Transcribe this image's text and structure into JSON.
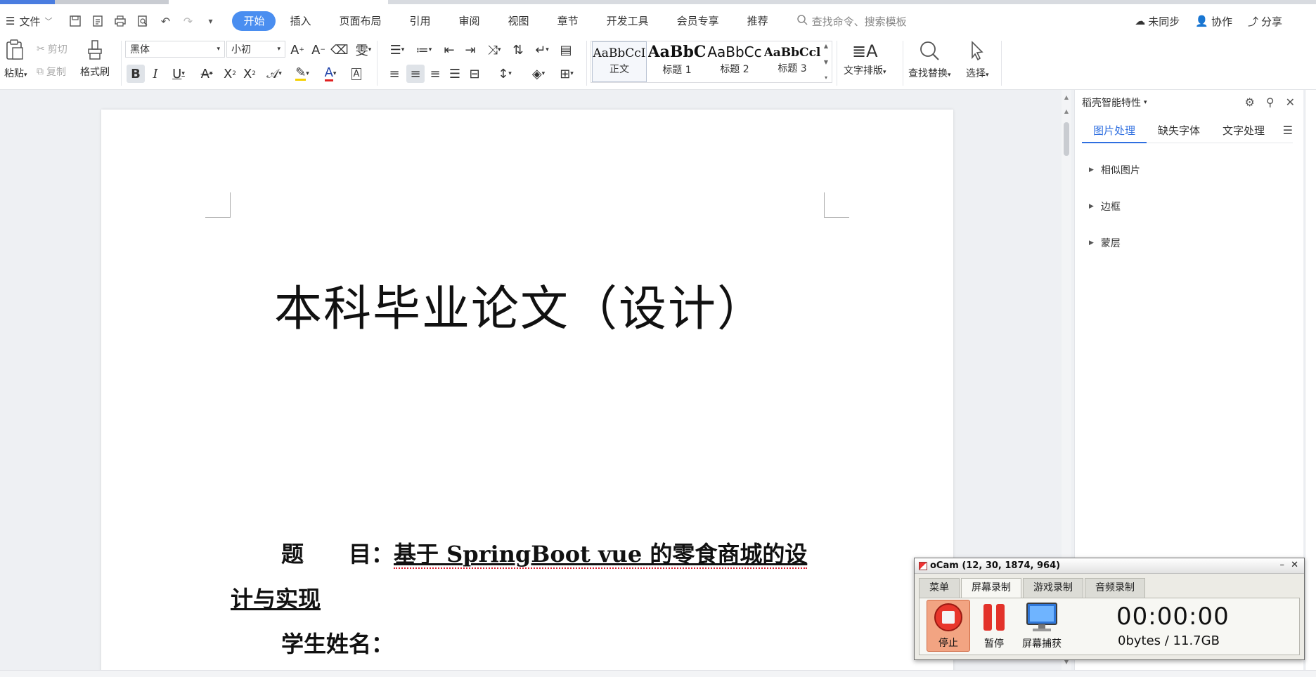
{
  "menubar": {
    "file_label": "文件",
    "tabs": [
      {
        "label": "开始",
        "active": true
      },
      {
        "label": "插入"
      },
      {
        "label": "页面布局"
      },
      {
        "label": "引用"
      },
      {
        "label": "审阅"
      },
      {
        "label": "视图"
      },
      {
        "label": "章节"
      },
      {
        "label": "开发工具"
      },
      {
        "label": "会员专享"
      },
      {
        "label": "推荐"
      }
    ],
    "search_placeholder": "查找命令、搜索模板",
    "right": {
      "sync": "未同步",
      "collab": "协作",
      "share": "分享"
    }
  },
  "ribbon": {
    "paste": "粘贴",
    "cut": "剪切",
    "copy": "复制",
    "format_painter": "格式刷",
    "font_name": "黑体",
    "font_size": "小初",
    "styles": [
      {
        "sample": "AaBbCcI",
        "label": "正文"
      },
      {
        "sample": "AaBbC",
        "label": "标题 1"
      },
      {
        "sample": "AaBbCc",
        "label": "标题 2"
      },
      {
        "sample": "AaBbCcl",
        "label": "标题 3"
      }
    ],
    "text_layout": "文字排版",
    "find_replace": "查找替换",
    "select": "选择"
  },
  "document": {
    "title": "本科毕业论文（设计）",
    "topic_label": "题　　目：",
    "topic_value_1": "基于 SpringBoot vue 的零食商城的设",
    "topic_value_2": "计与实现",
    "student_label": "学生姓名："
  },
  "panel": {
    "title": "稻壳智能特性",
    "tabs": [
      {
        "label": "图片处理",
        "active": true
      },
      {
        "label": "缺失字体"
      },
      {
        "label": "文字处理"
      }
    ],
    "sections": [
      "相似图片",
      "边框",
      "蒙层"
    ]
  },
  "ocam": {
    "title": "oCam (12, 30, 1874, 964)",
    "tabs": [
      {
        "label": "菜单"
      },
      {
        "label": "屏幕录制",
        "active": true
      },
      {
        "label": "游戏录制"
      },
      {
        "label": "音频录制"
      }
    ],
    "stop": "停止",
    "pause": "暂停",
    "capture": "屏幕捕获",
    "time": "00:00:00",
    "size": "0bytes / 11.7GB"
  },
  "colors": {
    "accent": "#4a8ef0",
    "active_tab_text": "#2f6fe0",
    "ocam_stop": "#f2a482"
  }
}
